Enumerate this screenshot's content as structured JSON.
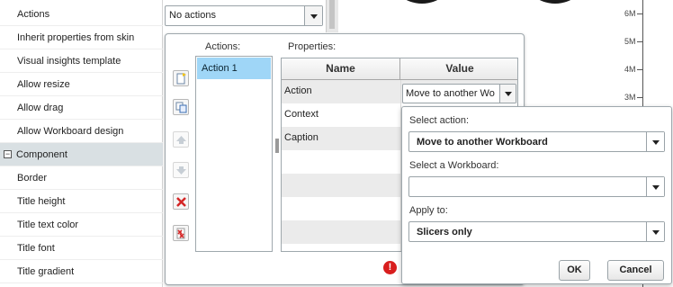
{
  "property_list": {
    "items": [
      {
        "label": "Actions"
      },
      {
        "label": "Inherit properties from skin"
      },
      {
        "label": "Visual insights template"
      },
      {
        "label": "Allow resize"
      },
      {
        "label": "Allow drag"
      },
      {
        "label": "Allow Workboard design"
      },
      {
        "label": "Component",
        "group": true,
        "expander": "⊟"
      },
      {
        "label": "Border"
      },
      {
        "label": "Title height"
      },
      {
        "label": "Title text color"
      },
      {
        "label": "Title font"
      },
      {
        "label": "Title gradient"
      }
    ]
  },
  "actions_dropdown": {
    "value": "No actions"
  },
  "chart_axis": {
    "ticks": [
      "6M",
      "5M",
      "4M",
      "3M"
    ]
  },
  "dialog": {
    "actions_label": "Actions:",
    "properties_label": "Properties:",
    "actions": [
      "Action 1"
    ],
    "toolbar": {
      "new_icon": "new-action-icon",
      "copy_icon": "copy-action-icon",
      "up_icon": "move-up-icon",
      "down_icon": "move-down-icon",
      "delete_icon": "delete-action-icon",
      "delete_all_icon": "delete-all-actions-icon"
    },
    "grid": {
      "col_name": "Name",
      "col_value": "Value",
      "rows": [
        {
          "name": "Action"
        },
        {
          "name": "Context"
        },
        {
          "name": "Caption"
        }
      ],
      "action_value": "Move to another Wo"
    },
    "warning_icon": "warning-icon"
  },
  "popup": {
    "select_action_label": "Select action:",
    "select_action_value": "Move to another Workboard",
    "select_workboard_label": "Select a Workboard:",
    "select_workboard_value": "",
    "apply_to_label": "Apply to:",
    "apply_to_value": "Slicers only",
    "ok_label": "OK",
    "cancel_label": "Cancel"
  },
  "colors": {
    "selection": "#9fd6f7",
    "group_row": "#d9e0e3",
    "warning": "#d81e1e"
  }
}
